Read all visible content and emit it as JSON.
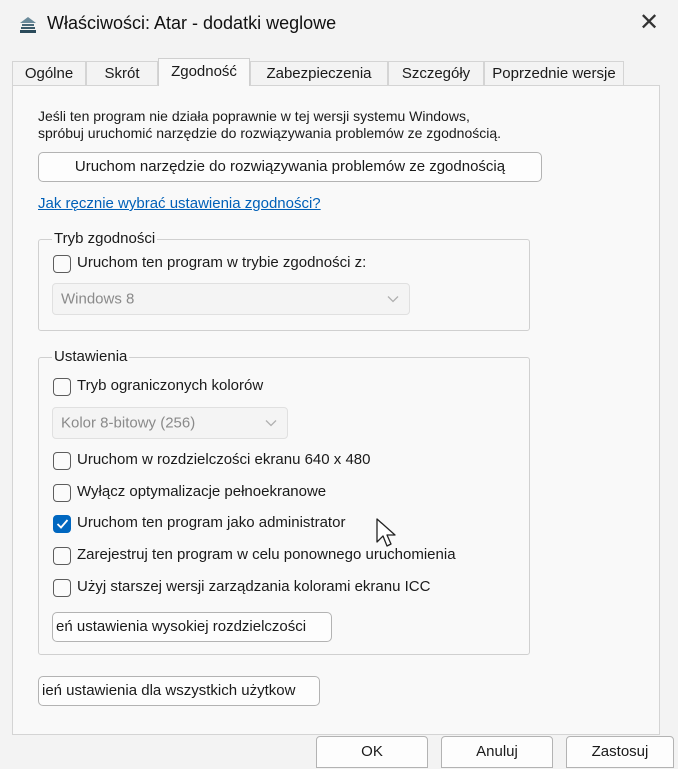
{
  "window": {
    "title": "Właściwości: Atar - dodatki weglowe",
    "close_glyph": "✕"
  },
  "tabs": [
    {
      "label": "Ogólne",
      "active": false
    },
    {
      "label": "Skrót",
      "active": false
    },
    {
      "label": "Zgodność",
      "active": true
    },
    {
      "label": "Zabezpieczenia",
      "active": false
    },
    {
      "label": "Szczegóły",
      "active": false
    },
    {
      "label": "Poprzednie wersje",
      "active": false
    }
  ],
  "compat": {
    "intro_line1": "Jeśli ten program nie działa poprawnie w tej wersji systemu Windows,",
    "intro_line2": "spróbuj uruchomić narzędzie do rozwiązywania problemów ze zgodnością.",
    "troubleshooter_button": "Uruchom narzędzie do rozwiązywania problemów ze zgodnością",
    "manual_link": "Jak ręcznie wybrać ustawienia zgodności?"
  },
  "mode_group": {
    "label": "Tryb zgodności",
    "checkbox_label": "Uruchom ten program w trybie zgodności z:",
    "checked": false,
    "select_value": "Windows 8"
  },
  "settings_group": {
    "label": "Ustawienia",
    "reduced_color": {
      "label": "Tryb ograniczonych kolorów",
      "checked": false
    },
    "color_select_value": "Kolor 8-bitowy (256)",
    "resolution_640": {
      "label": "Uruchom w rozdzielczości ekranu 640 x 480",
      "checked": false
    },
    "disable_fullscreen_opt": {
      "label": "Wyłącz optymalizacje pełnoekranowe",
      "checked": false
    },
    "run_as_admin": {
      "label": "Uruchom ten program jako administrator",
      "checked": true
    },
    "register_restart": {
      "label": "Zarejestruj ten program w celu ponownego uruchomienia",
      "checked": false
    },
    "legacy_icc": {
      "label": "Użyj starszej wersji zarządzania kolorami ekranu ICC",
      "checked": false
    },
    "high_dpi_button": "eń ustawienia wysokiej rozdzielczości"
  },
  "all_users_button": "ień ustawienia dla wszystkich użytkow",
  "footer": {
    "ok": "OK",
    "cancel": "Anuluj",
    "apply": "Zastosuj"
  },
  "icons": {
    "app": "app-icon",
    "close": "close-icon",
    "chevron": "chevron-down-icon",
    "check": "checkmark-icon",
    "cursor": "mouse-pointer-icon"
  },
  "colors": {
    "accent": "#0067c0",
    "link": "#0060b8"
  }
}
